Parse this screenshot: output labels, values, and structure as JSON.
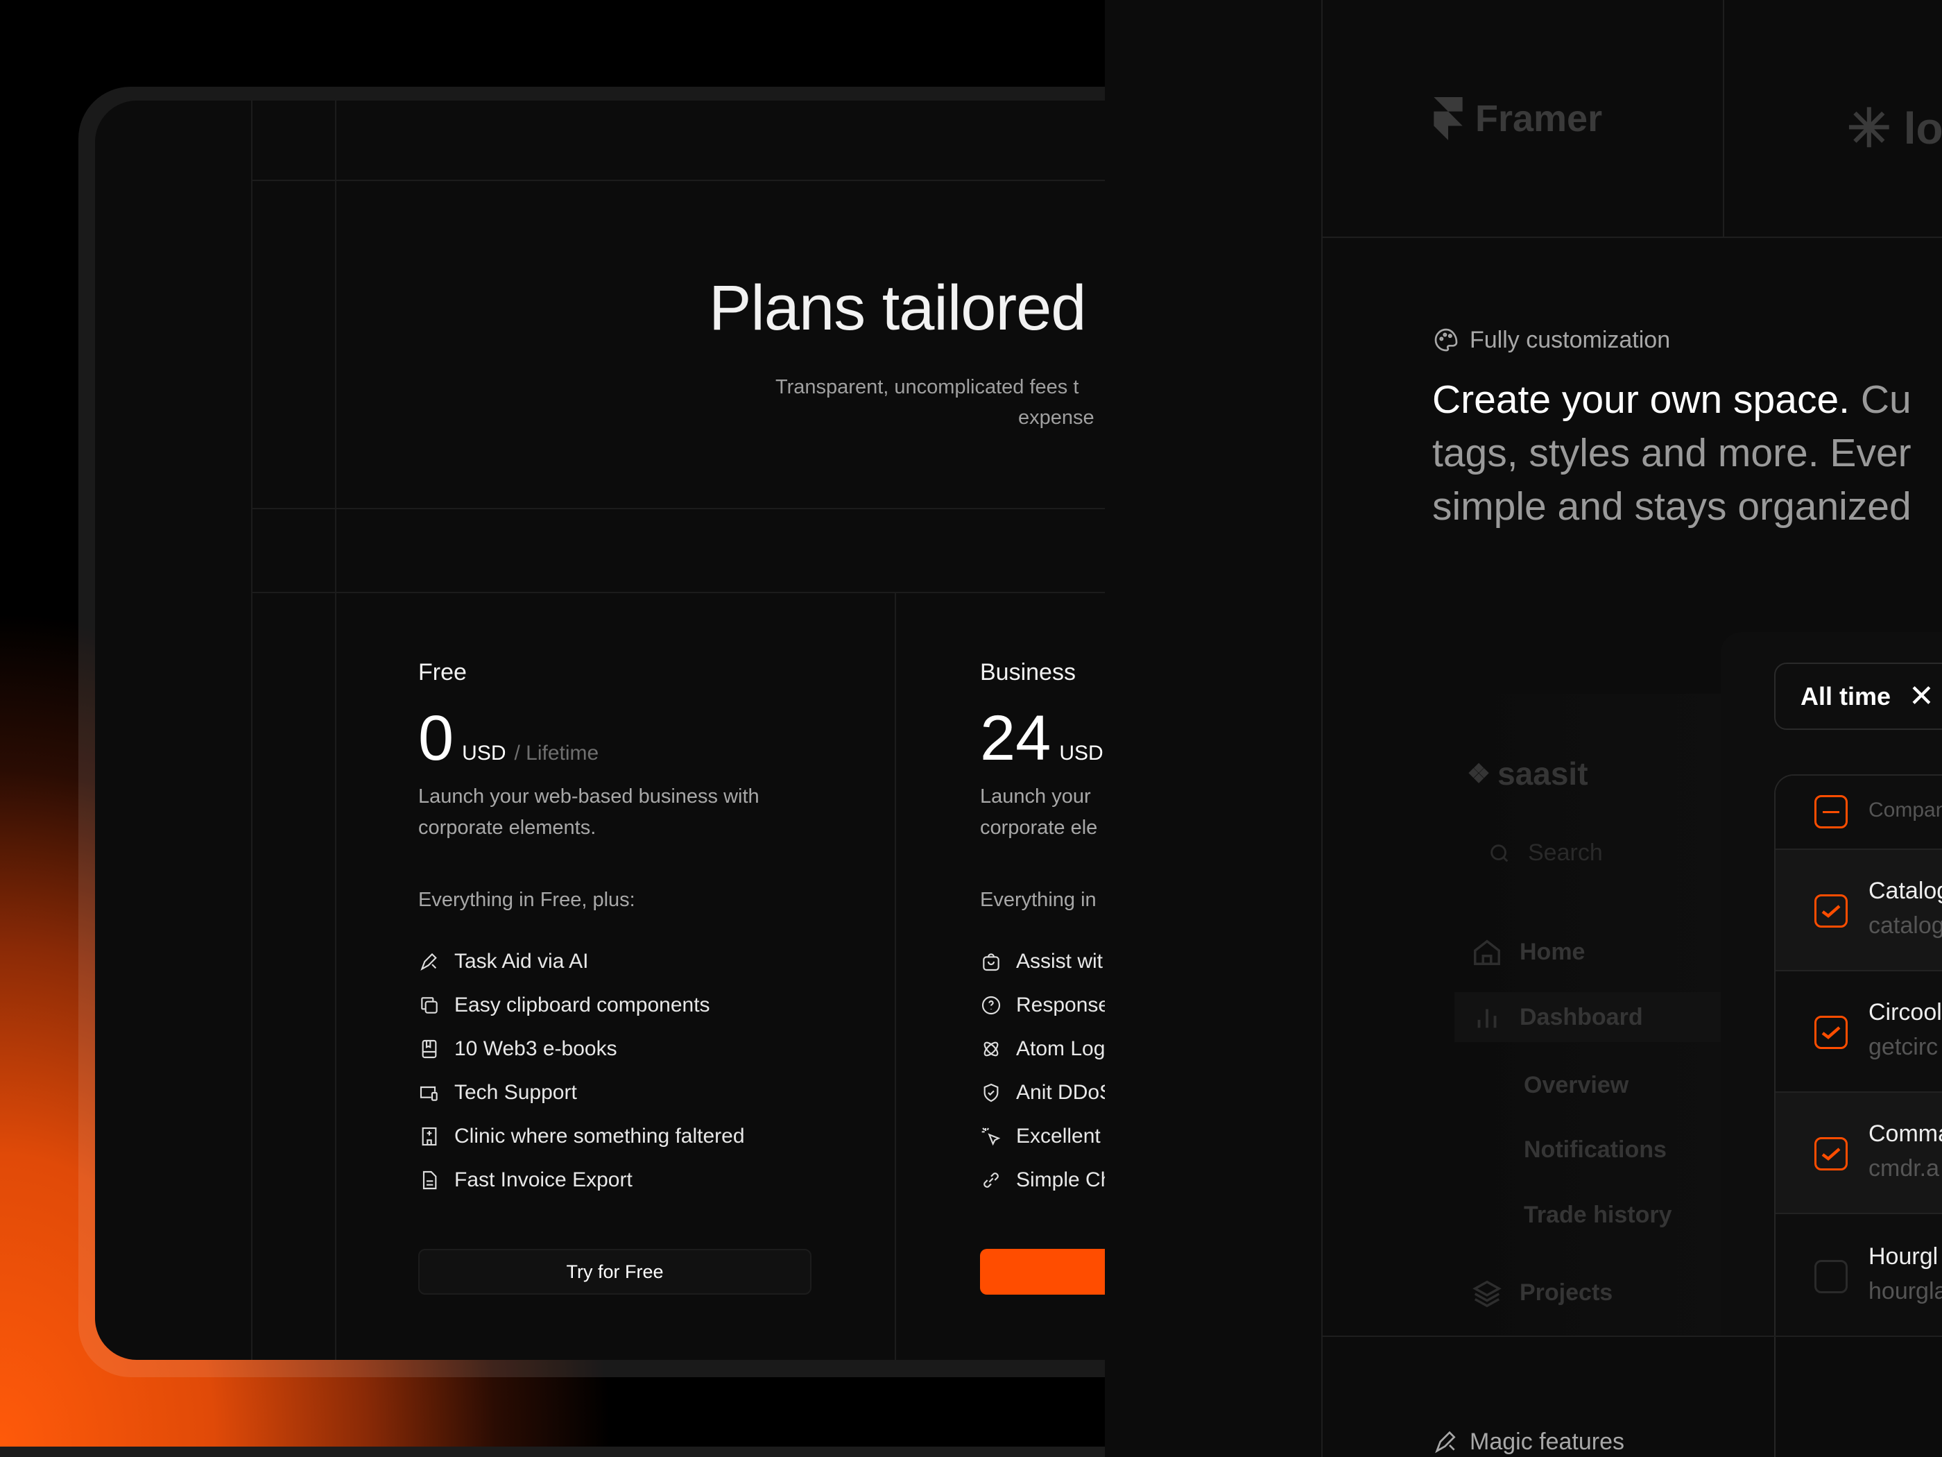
{
  "colors": {
    "accent": "#ff4d00",
    "background": "#0c0c0c"
  },
  "pricing": {
    "title": "Plans tailored",
    "subtitle_lines": [
      "Transparent, uncomplicated fees t",
      "expense"
    ],
    "plans": [
      {
        "name": "Free",
        "price": "0",
        "currency": "USD",
        "period": "/ Lifetime",
        "description_lines": [
          "Launch your web-based business with",
          "corporate elements."
        ],
        "includes": "Everything in Free, plus:",
        "features": [
          {
            "icon": "pen-tool-icon",
            "label": "Task Aid via AI"
          },
          {
            "icon": "copy-icon",
            "label": "Easy clipboard components"
          },
          {
            "icon": "book-icon",
            "label": "10 Web3 e-books"
          },
          {
            "icon": "devices-icon",
            "label": "Tech Support"
          },
          {
            "icon": "hospital-icon",
            "label": "Clinic where something faltered"
          },
          {
            "icon": "file-text-icon",
            "label": "Fast Invoice Export"
          }
        ],
        "button": "Try for Free"
      },
      {
        "name": "Business",
        "price": "24",
        "currency": "USD",
        "description_lines": [
          "Launch your",
          "corporate ele"
        ],
        "includes": "Everything in",
        "features": [
          {
            "icon": "shopping-bag-icon",
            "label": "Assist wit"
          },
          {
            "icon": "help-circle-icon",
            "label": "Response"
          },
          {
            "icon": "atom-icon",
            "label": "Atom Log"
          },
          {
            "icon": "shield-check-icon",
            "label": "Anit DDoS"
          },
          {
            "icon": "sparkle-cursor-icon",
            "label": "Excellent"
          },
          {
            "icon": "link-icon",
            "label": "Simple Ch"
          }
        ]
      }
    ]
  },
  "logos": [
    "Framer",
    "lo"
  ],
  "feature": {
    "eyebrow": "Fully customization",
    "heading_white": "Create your own space.",
    "heading_lines": [
      " Cu",
      "tags, styles and more. Ever",
      "simple and stays organized"
    ]
  },
  "dashboard": {
    "brand": "saasit",
    "search_placeholder": "Search",
    "nav": [
      "Home",
      "Dashboard",
      "Overview",
      "Notifications",
      "Trade history",
      "Projects"
    ],
    "filter_chip": "All time",
    "table_header": "Compan",
    "rows": [
      {
        "name": "Catalog",
        "domain": "catalog",
        "checked": true
      },
      {
        "name": "Circool",
        "domain": "getcirc",
        "checked": true
      },
      {
        "name": "Comma",
        "domain": "cmdr.a",
        "checked": true
      },
      {
        "name": "Hourgl",
        "domain": "hourgla",
        "checked": false
      }
    ]
  },
  "next_section": {
    "eyebrow": "Magic features"
  }
}
